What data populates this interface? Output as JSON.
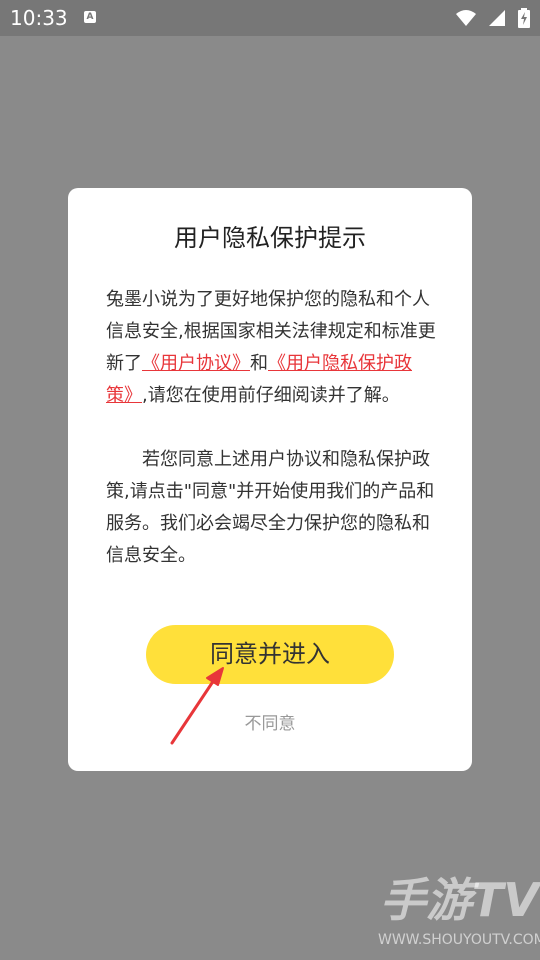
{
  "status_bar": {
    "time": "10:33",
    "icons": [
      "wifi-icon",
      "signal-icon",
      "battery-charging-icon"
    ]
  },
  "dialog": {
    "title": "用户隐私保护提示",
    "para1_a": "兔墨小说为了更好地保护您的隐私和个人信息安全,根据国家相关法律规定和标准更新了",
    "link_user_agreement": "《用户协议》",
    "para1_and": "和",
    "link_privacy_policy": "《用户隐私保护政策》",
    "para1_b": ",请您在使用前仔细阅读并了解。",
    "para2": "若您同意上述用户协议和隐私保护政策,请点击\"同意\"并开始使用我们的产品和服务。我们必会竭尽全力保护您的隐私和信息安全。",
    "agree_label": "同意并进入",
    "disagree_label": "不同意",
    "link_color": "#e8363a",
    "button_color": "#ffe03a"
  },
  "watermark": {
    "logo_text": "手游TV",
    "url": "WWW.SHOUYOUTV.COM"
  }
}
